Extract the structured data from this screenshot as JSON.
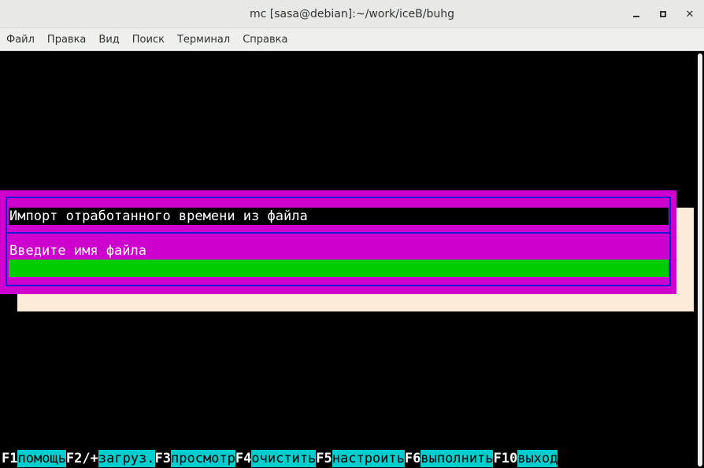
{
  "window": {
    "title": "mc [sasa@debian]:~/work/iceB/buhg"
  },
  "menu": {
    "items": [
      "Файл",
      "Правка",
      "Вид",
      "Поиск",
      "Терминал",
      "Справка"
    ]
  },
  "dialog": {
    "title": "Импорт отработанного времени из файла",
    "prompt": "Введите имя файла",
    "input_value": ""
  },
  "fkeys": [
    {
      "key": "F1",
      "label": "помощь"
    },
    {
      "key": "F2/+",
      "label": "загруз."
    },
    {
      "key": "F3",
      "label": "просмотр"
    },
    {
      "key": "F4",
      "label": "очистить"
    },
    {
      "key": "F5",
      "label": "настроить"
    },
    {
      "key": "F6",
      "label": "выполнить"
    },
    {
      "key": "F10",
      "label": "выход"
    }
  ],
  "colors": {
    "dialog_bg": "#cd00cd",
    "dialog_border": "#1a1ad4",
    "input_bg": "#00cd00",
    "shadow": "#fbebd8",
    "fkey_label_bg": "#00cdcd"
  }
}
